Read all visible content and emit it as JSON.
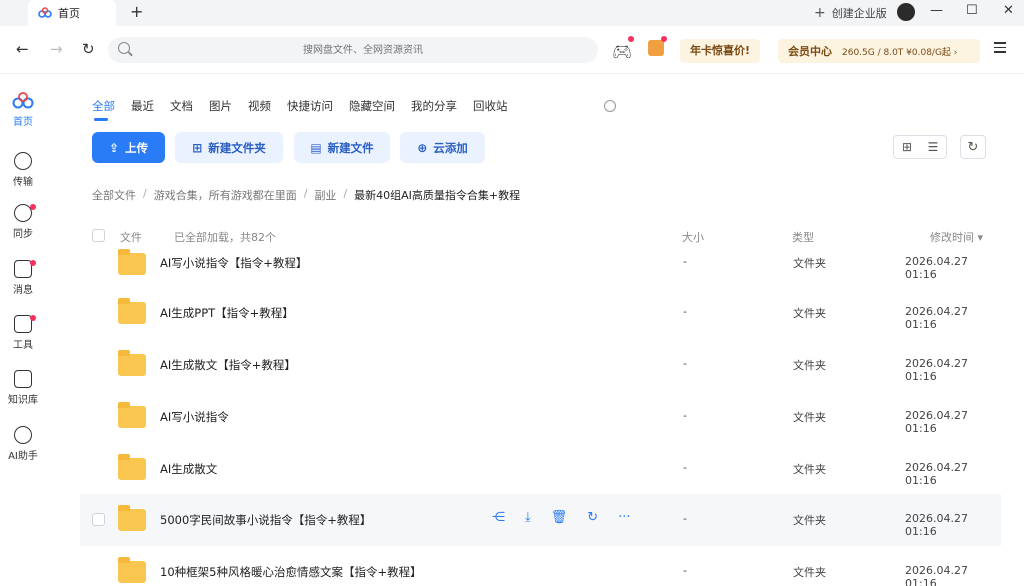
{
  "window": {
    "tab_title": "首页",
    "new_tab": "+",
    "corp_label": "创建企业版",
    "min": "—",
    "max": "☐",
    "close": "✕"
  },
  "address": {
    "placeholder": "搜网盘文件、全网资源资讯",
    "promo": "年卡惊喜价!",
    "vip_label": "会员中心",
    "vip_info": "260.5G / 8.0T  ¥0.08/G起 ›"
  },
  "sidebar": {
    "items": [
      {
        "label": "首页"
      },
      {
        "label": "传输"
      },
      {
        "label": "同步"
      },
      {
        "label": "消息"
      },
      {
        "label": "工具"
      },
      {
        "label": "知识库"
      },
      {
        "label": "AI助手"
      }
    ]
  },
  "tabs": [
    "全部",
    "最近",
    "文档",
    "图片",
    "视频",
    "快捷访问",
    "隐藏空间",
    "我的分享",
    "回收站"
  ],
  "buttons": {
    "upload": "上传",
    "new_folder": "新建文件夹",
    "new_file": "新建文件",
    "cloud_add": "云添加"
  },
  "breadcrumb": [
    "全部文件",
    "游戏合集，所有游戏都在里面",
    "副业",
    "最新40组AI高质量指令合集+教程"
  ],
  "table": {
    "col_file": "文件",
    "loaded": "已全部加载，共82个",
    "col_size": "大小",
    "col_type": "类型",
    "col_time": "修改时间 ▾"
  },
  "rows": [
    {
      "name": "AI写小说指令【指令+教程】",
      "size": "-",
      "type": "文件夹",
      "time": "2026.04.27 01:16"
    },
    {
      "name": "AI生成PPT【指令+教程】",
      "size": "-",
      "type": "文件夹",
      "time": "2026.04.27 01:16"
    },
    {
      "name": "AI生成散文【指令+教程】",
      "size": "-",
      "type": "文件夹",
      "time": "2026.04.27 01:16"
    },
    {
      "name": "AI写小说指令",
      "size": "-",
      "type": "文件夹",
      "time": "2026.04.27 01:16"
    },
    {
      "name": "AI生成散文",
      "size": "-",
      "type": "文件夹",
      "time": "2026.04.27 01:16"
    },
    {
      "name": "5000字民间故事小说指令【指令+教程】",
      "size": "-",
      "type": "文件夹",
      "time": "2026.04.27 01:16"
    },
    {
      "name": "10种框架5种风格暖心治愈情感文案【指令+教程】",
      "size": "-",
      "type": "文件夹",
      "time": "2026.04.27 01:16"
    }
  ],
  "colors": {
    "accent": "#2a7bf6",
    "folder": "#f9c74f",
    "promo_bg": "#fdf3e1"
  }
}
